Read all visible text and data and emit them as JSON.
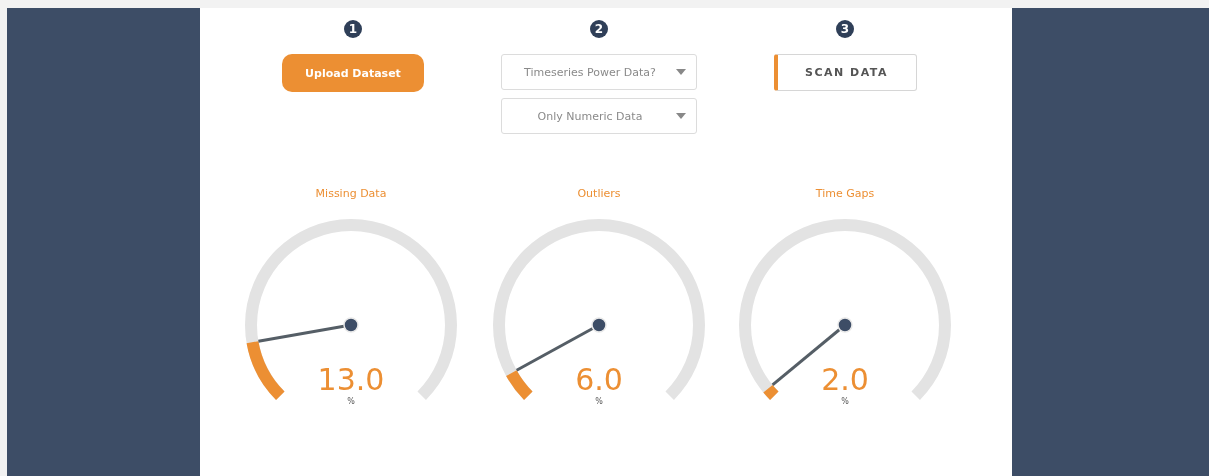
{
  "steps": [
    {
      "number": "1",
      "kind": "button",
      "label": "Upload Dataset"
    },
    {
      "number": "2",
      "kind": "dropdowns",
      "selects": [
        {
          "placeholder": "Timeseries Power Data?"
        },
        {
          "placeholder": "Only Numeric Data"
        }
      ]
    },
    {
      "number": "3",
      "kind": "scan_button",
      "label": "SCAN DATA"
    }
  ],
  "gauges": [
    {
      "title": "Missing Data",
      "value": "13.0",
      "unit": "%"
    },
    {
      "title": "Outliers",
      "value": "6.0",
      "unit": "%"
    },
    {
      "title": "Time Gaps",
      "value": "2.0",
      "unit": "%"
    }
  ]
}
